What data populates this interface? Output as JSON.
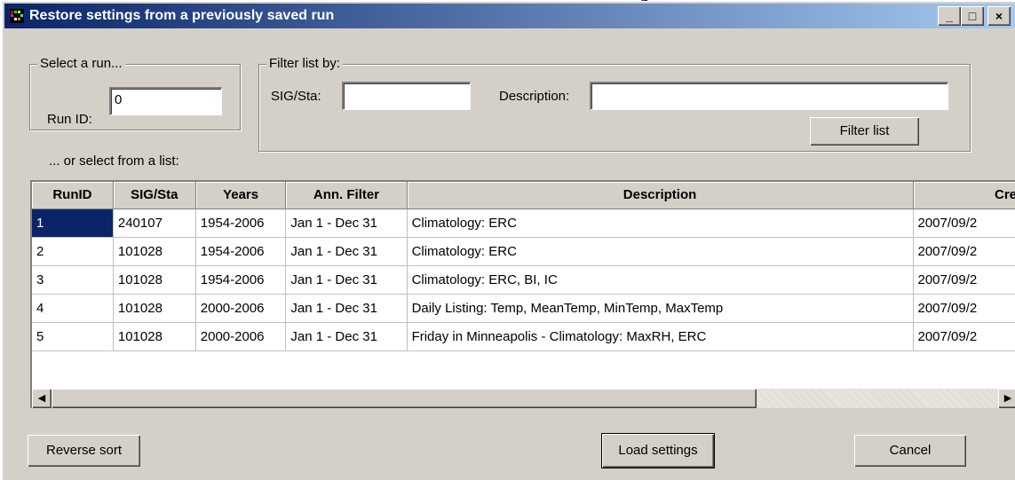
{
  "background_caption": "g",
  "window": {
    "title": "Restore settings from a previously saved run",
    "buttons": {
      "minimize": "_",
      "maximize": "□",
      "close": "×"
    }
  },
  "select_run": {
    "group_label": "Select a run...",
    "run_id_label": "Run ID:",
    "run_id_value": "0"
  },
  "filter": {
    "group_label": "Filter list by:",
    "sig_label": "SIG/Sta:",
    "sig_value": "",
    "desc_label": "Description:",
    "desc_value": "",
    "button_label": "Filter list"
  },
  "list_label": "... or select from a list:",
  "table": {
    "columns": [
      "RunID",
      "SIG/Sta",
      "Years",
      "Ann. Filter",
      "Description",
      "Cre"
    ],
    "rows": [
      {
        "run_id": "1",
        "sig": "240107",
        "years": "1954-2006",
        "filter": "Jan 1 - Dec 31",
        "description": "Climatology: ERC",
        "created": "2007/09/2"
      },
      {
        "run_id": "2",
        "sig": "101028",
        "years": "1954-2006",
        "filter": "Jan 1 - Dec 31",
        "description": "Climatology: ERC",
        "created": "2007/09/2"
      },
      {
        "run_id": "3",
        "sig": "101028",
        "years": "1954-2006",
        "filter": "Jan 1 - Dec 31",
        "description": "Climatology: ERC, BI, IC",
        "created": "2007/09/2"
      },
      {
        "run_id": "4",
        "sig": "101028",
        "years": "2000-2006",
        "filter": "Jan 1 - Dec 31",
        "description": "Daily Listing: Temp, MeanTemp, MinTemp, MaxTemp",
        "created": "2007/09/2"
      },
      {
        "run_id": "5",
        "sig": "101028",
        "years": "2000-2006",
        "filter": "Jan 1 - Dec 31",
        "description": "Friday in Minneapolis - Climatology: MaxRH, ERC",
        "created": "2007/09/2"
      }
    ],
    "selected_row": 1
  },
  "scrollbar": {
    "left_arrow": "◀",
    "right_arrow": "▶"
  },
  "buttons": {
    "reverse_sort": "Reverse sort",
    "load_settings": "Load settings",
    "cancel": "Cancel"
  },
  "colors": {
    "title_gradient_start": "#0a246a",
    "title_gradient_end": "#a6caf0",
    "face": "#d4d0c8",
    "selection": "#0a246a"
  }
}
